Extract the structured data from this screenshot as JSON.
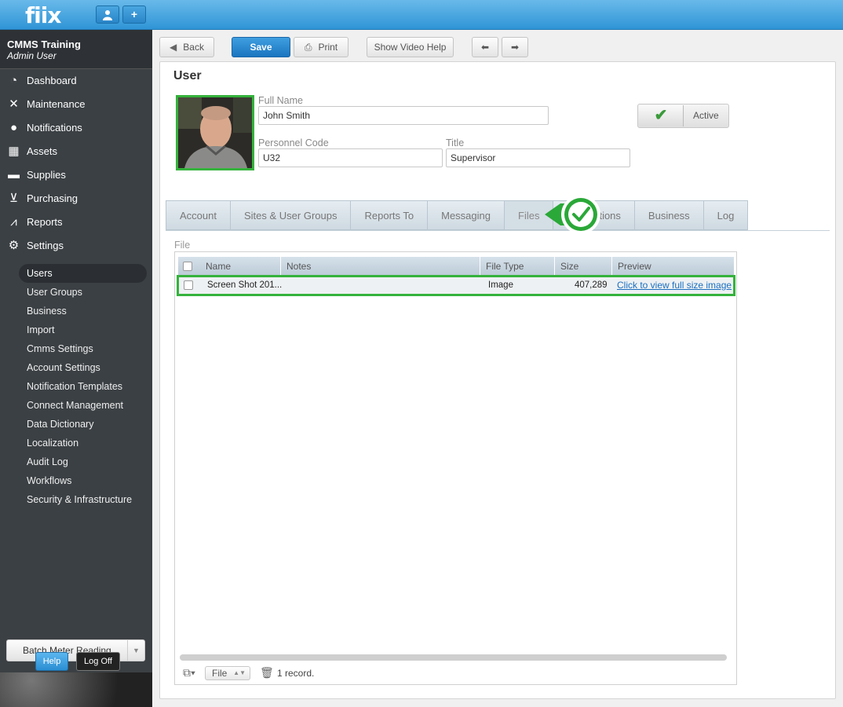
{
  "topbar": {
    "logo": "fiix",
    "user_icon": "user-icon",
    "add_icon": "plus-icon",
    "add_label": "+"
  },
  "account": {
    "org": "CMMS Training",
    "role": "Admin User"
  },
  "nav": [
    {
      "label": "Dashboard",
      "icon": "dashboard-icon"
    },
    {
      "label": "Maintenance",
      "icon": "tools-icon"
    },
    {
      "label": "Notifications",
      "icon": "speech-bubble-icon"
    },
    {
      "label": "Assets",
      "icon": "boxes-icon"
    },
    {
      "label": "Supplies",
      "icon": "truck-icon"
    },
    {
      "label": "Purchasing",
      "icon": "cart-icon"
    },
    {
      "label": "Reports",
      "icon": "chart-icon"
    },
    {
      "label": "Settings",
      "icon": "gear-icon"
    }
  ],
  "subnav": [
    "Users",
    "User Groups",
    "Business",
    "Import",
    "Cmms Settings",
    "Account Settings",
    "Notification Templates",
    "Connect Management",
    "Data Dictionary",
    "Localization",
    "Audit Log",
    "Workflows",
    "Security & Infrastructure"
  ],
  "sidebar_footer": {
    "batch": "Batch Meter Reading",
    "help": "Help",
    "logoff": "Log Off"
  },
  "toolbar": {
    "back": "Back",
    "save": "Save",
    "print": "Print",
    "video_help": "Show Video Help"
  },
  "page": {
    "title": "User"
  },
  "form": {
    "full_name_label": "Full Name",
    "full_name": "John Smith",
    "personnel_code_label": "Personnel Code",
    "personnel_code": "U32",
    "title_label": "Title",
    "title": "Supervisor",
    "status": "Active"
  },
  "tabs": [
    "Account",
    "Sites & User Groups",
    "Reports To",
    "Messaging",
    "Files",
    "Notifications",
    "Business",
    "Log"
  ],
  "tabs_visible": [
    "Account",
    "Sites & User Groups",
    "Reports To",
    "Messaging",
    "Files",
    "tions",
    "Business",
    "Log"
  ],
  "files": {
    "section_label": "File",
    "columns": [
      "Name",
      "Notes",
      "File Type",
      "Size",
      "Preview"
    ],
    "rows": [
      {
        "name": "Screen Shot 201...",
        "notes": "",
        "type": "Image",
        "size": "407,289",
        "preview": "Click to view full size image"
      }
    ],
    "footer": {
      "type_select": "File",
      "record_count": "1 record."
    }
  },
  "colors": {
    "accent": "#2f95d6",
    "highlight": "#35b23c",
    "sidebar": "#3b4044"
  }
}
